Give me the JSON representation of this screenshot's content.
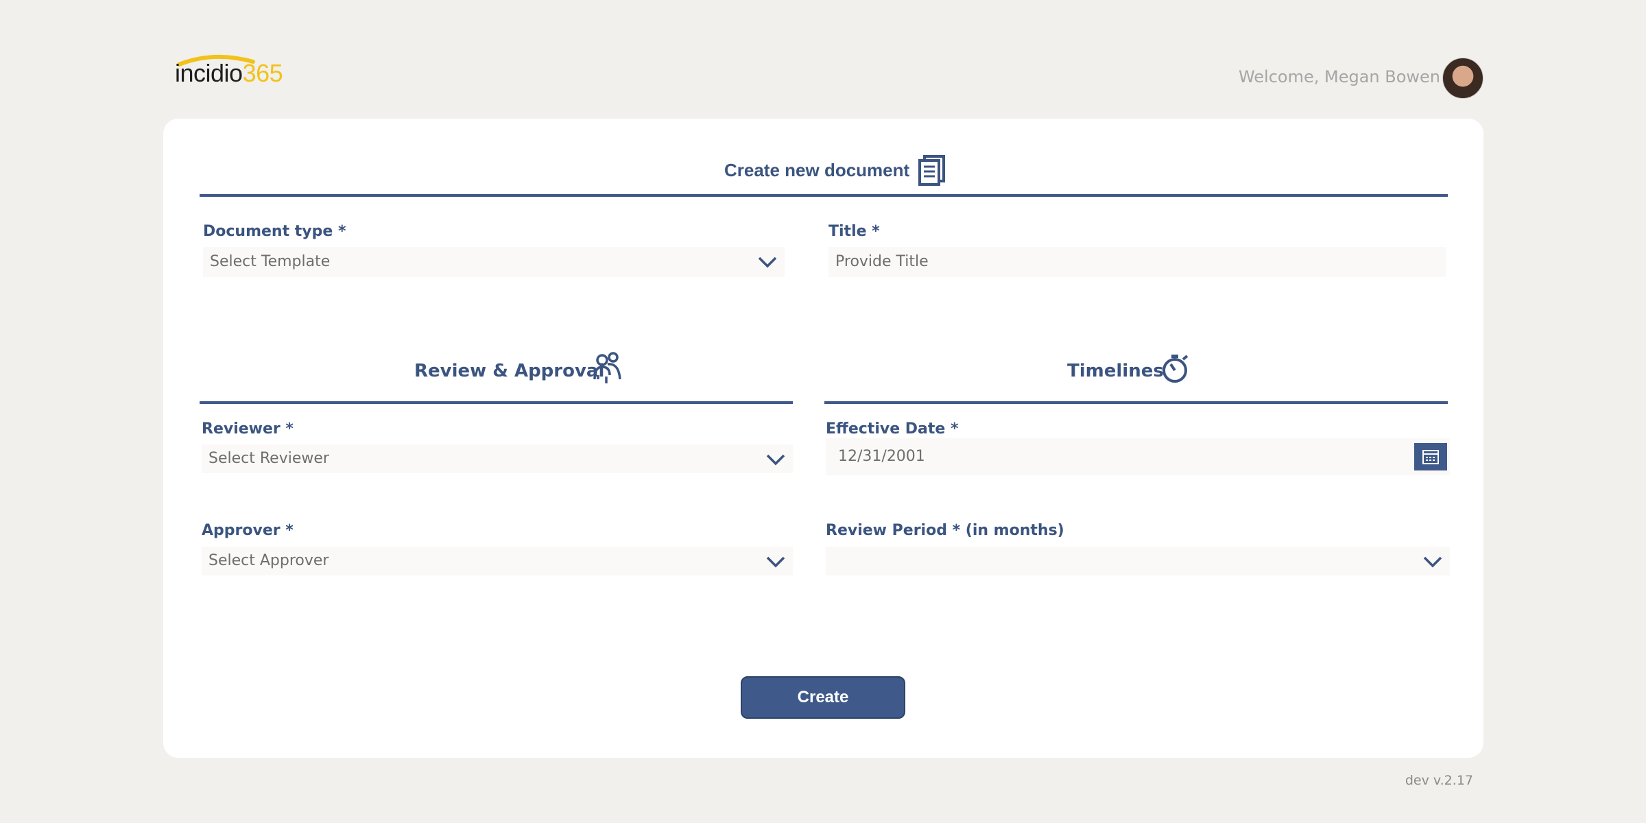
{
  "header": {
    "logo_main": "incidio",
    "logo_num": "365",
    "welcome": "Welcome, Megan Bowen"
  },
  "form": {
    "title": "Create new document",
    "document_type": {
      "label": "Document type *",
      "placeholder": "Select Template"
    },
    "doc_title": {
      "label": "Title *",
      "placeholder": "Provide Title"
    },
    "review_section": "Review & Approval",
    "timelines_section": "Timelines",
    "reviewer": {
      "label": "Reviewer *",
      "placeholder": "Select Reviewer"
    },
    "approver": {
      "label": "Approver *",
      "placeholder": "Select Approver"
    },
    "effective_date": {
      "label": "Effective Date *",
      "value": "12/31/2001"
    },
    "review_period": {
      "label": "Review Period * (in months)",
      "value": ""
    },
    "create_label": "Create"
  },
  "footer": {
    "version": "dev v.2.17"
  },
  "colors": {
    "accent": "#3f5a8a",
    "logo_yellow": "#f2c21b"
  },
  "icons": [
    "document-icon",
    "people-icon",
    "timer-icon",
    "chevron-down-icon",
    "calendar-icon"
  ]
}
